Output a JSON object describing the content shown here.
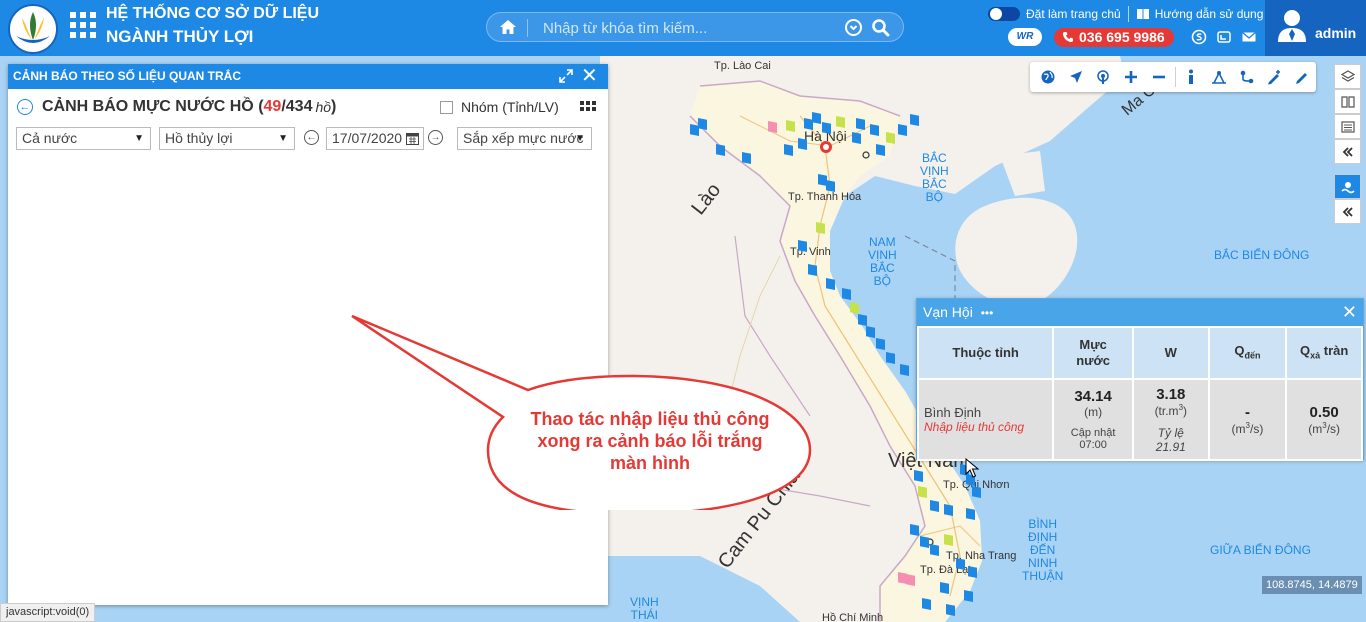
{
  "header": {
    "title_line1": "HỆ THỐNG CƠ SỞ DỮ LIỆU",
    "title_line2": "NGÀNH THỦY LỢI",
    "search_placeholder": "Nhập từ khóa tìm kiếm...",
    "set_home_label": "Đặt làm trang chủ",
    "guide_label": "Hướng dẫn sử dụng",
    "wr_badge": "WR",
    "phone": "036 695 9986",
    "username": "admin"
  },
  "panel": {
    "header_title": "CẢNH BÁO THEO SỐ LIỆU QUAN TRẮC",
    "title_prefix": "CẢNH BÁO MỰC NƯỚC HỒ (",
    "count_alert": "49",
    "count_sep": "/",
    "count_total": "434",
    "count_unit": "hồ",
    "title_suffix": ")",
    "group_label": "Nhóm (Tỉnh/LV)",
    "region_value": "Cả nước",
    "type_value": "Hồ thủy lợi",
    "date_value": "17/07/2020",
    "sort_value": "Sắp xếp mực nước"
  },
  "map": {
    "labels": {
      "lao_cai": "Tp. Lào Cai",
      "ha_noi": "Hà Nội",
      "thanh_hoa": "Tp. Thanh Hóa",
      "vinh": "Tp. Vinh",
      "qui_nhon": "Tp. Qui Nhơn",
      "nha_trang": "Tp. Nha Trang",
      "da_lat": "Tp. Đà Lạt",
      "ho_chi_minh": "Hồ Chí Minh"
    },
    "countries": {
      "lao": "Lào",
      "cambodia": "Cam Pu Chia",
      "vietnam": "Việt Nam"
    },
    "seas": {
      "bac_vinh_bac_bo": "BẮC\nVỊNH\nBẮC\nBỘ",
      "nam_vinh_bac_bo": "NAM\nVỊNH\nBẮC\nBỘ",
      "bac_bien_dong": "BẮC BIỂN ĐÔNG",
      "giua_bien_dong": "GIỮA BIỂN ĐÔNG",
      "binh_dinh_ninh_thuan": "BÌNH\nĐỊNH\nĐẾN\nNINH\nTHUẬN",
      "vinh_thai": "VỊNH\nTHÁI",
      "macau": "Ma Cao"
    },
    "coords": "108.8745, 14.4879"
  },
  "popup": {
    "station": "Vạn Hội",
    "more": "•••",
    "col_province": "Thuộc tỉnh",
    "col_level": "Mực\nnước",
    "col_w": "W",
    "col_qin": "Q",
    "col_qin_sub": "đến",
    "col_qout": "Q",
    "col_qout_sub": "xả",
    "col_qout_suffix": " tràn",
    "province": "Bình Định",
    "manual_note": "Nhập liệu thủ công",
    "level_value": "34.14",
    "level_unit": "(m)",
    "updated_label": "Cập nhật",
    "updated_time": "07:00",
    "w_value": "3.18",
    "w_unit_pre": "(tr.m",
    "w_unit_sup": "3",
    "w_unit_post": ")",
    "ratio_label": "Tỷ lệ",
    "ratio_value": "21.91",
    "qin_value": "-",
    "qin_unit_pre": "(m",
    "qin_unit_sup": "3",
    "qin_unit_post": "/s)",
    "qout_value": "0.50",
    "qout_unit_pre": "(m",
    "qout_unit_sup": "3",
    "qout_unit_post": "/s)"
  },
  "callout": {
    "text": "Thao tác nhập liệu thủ công xong ra cảnh báo lỗi trắng màn hình"
  },
  "status_bar": "javascript:void(0)",
  "icons": {
    "apps": "apps-grid-icon",
    "home": "home-icon",
    "search": "search-icon",
    "phone": "phone-icon",
    "skype": "skype-icon",
    "email": "email-icon",
    "user": "user-icon"
  },
  "colors": {
    "header_bg": "#1e88e5",
    "alert_red": "#e53935",
    "marker_blue": "#1e88e5",
    "marker_yellow": "#c6e14a",
    "marker_pink": "#f48fb1"
  }
}
